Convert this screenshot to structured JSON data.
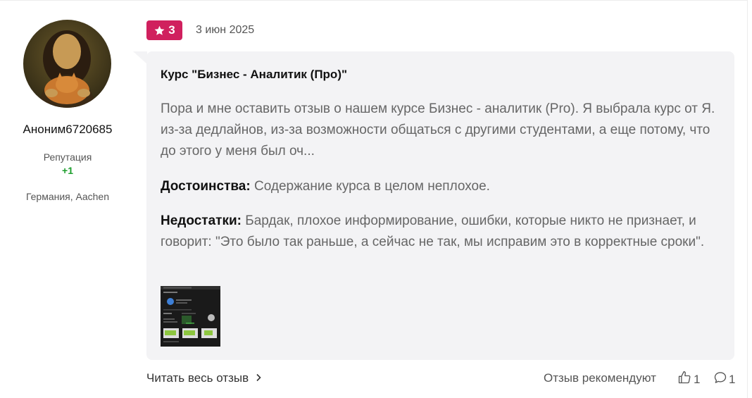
{
  "user": {
    "name": "Аноним6720685",
    "reputation_label": "Репутация",
    "reputation_value": "+1",
    "location": "Германия, Aachen"
  },
  "review": {
    "rating": "3",
    "rating_icon": "star-icon",
    "date": "3 июн 2025",
    "title": "Курс \"Бизнес - Аналитик (Про)\"",
    "text": "Пора и мне оставить отзыв о нашем курсе Бизнес - аналитик (Pro). Я выбрала курс от Я. из-за дедлайнов, из-за возможности общаться с другими студентами, а еще потому, что до этого у меня был оч...",
    "pros_label": "Достоинства:",
    "pros_text": "Содержание курса в целом неплохое.",
    "cons_label": "Недостатки:",
    "cons_text": "Бардак, плохое информирование, ошибки, которые никто не признает, и говорит: \"Это было так раньше, а сейчас не так, мы исправим это в корректные сроки\"."
  },
  "footer": {
    "read_more": "Читать весь отзыв",
    "recommend_label": "Отзыв рекомендуют",
    "likes_count": "1",
    "comments_count": "1"
  },
  "colors": {
    "rating_badge": "#d0205e",
    "reputation": "#1c9e2c",
    "bubble_bg": "#f3f3f5"
  }
}
